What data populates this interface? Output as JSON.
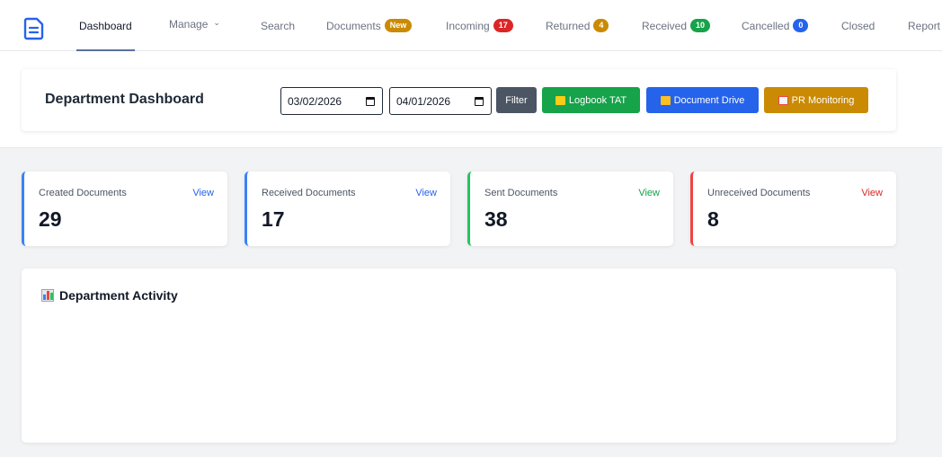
{
  "nav": {
    "items": [
      {
        "label": "Dashboard"
      },
      {
        "label": "Manage"
      },
      {
        "label": "Search"
      },
      {
        "label": "Documents",
        "badge": "New",
        "badge_color": "#ca8a04"
      },
      {
        "label": "Incoming",
        "badge": "17",
        "badge_color": "#dc2626"
      },
      {
        "label": "Returned",
        "badge": "4",
        "badge_color": "#ca8a04"
      },
      {
        "label": "Received",
        "badge": "10",
        "badge_color": "#16a34a"
      },
      {
        "label": "Cancelled",
        "badge": "0",
        "badge_color": "#2563eb"
      },
      {
        "label": "Closed"
      },
      {
        "label": "Report"
      }
    ],
    "active": "Dashboard"
  },
  "header": {
    "title": "Department Dashboard",
    "date_from": "03/02/2026",
    "date_to": "04/01/2026",
    "filter_label": "Filter",
    "logbook_label": "Logbook TAT",
    "drive_label": "Document Drive",
    "pr_label": "PR Monitoring"
  },
  "stats": [
    {
      "label": "Created Documents",
      "value": "29",
      "link": "View",
      "color": "#3b82f6"
    },
    {
      "label": "Received Documents",
      "value": "17",
      "link": "View",
      "color": "#3b82f6"
    },
    {
      "label": "Sent Documents",
      "value": "38",
      "link": "View",
      "color": "#16a34a"
    },
    {
      "label": "Unreceived Documents",
      "value": "8",
      "link": "View",
      "color": "#dc2626"
    }
  ],
  "activity": {
    "title": "Department Activity"
  },
  "colors": {
    "filter": "#4b5563",
    "logbook": "#16a34a",
    "drive": "#2563eb",
    "pr": "#ca8a04",
    "logo": "#2563eb"
  }
}
